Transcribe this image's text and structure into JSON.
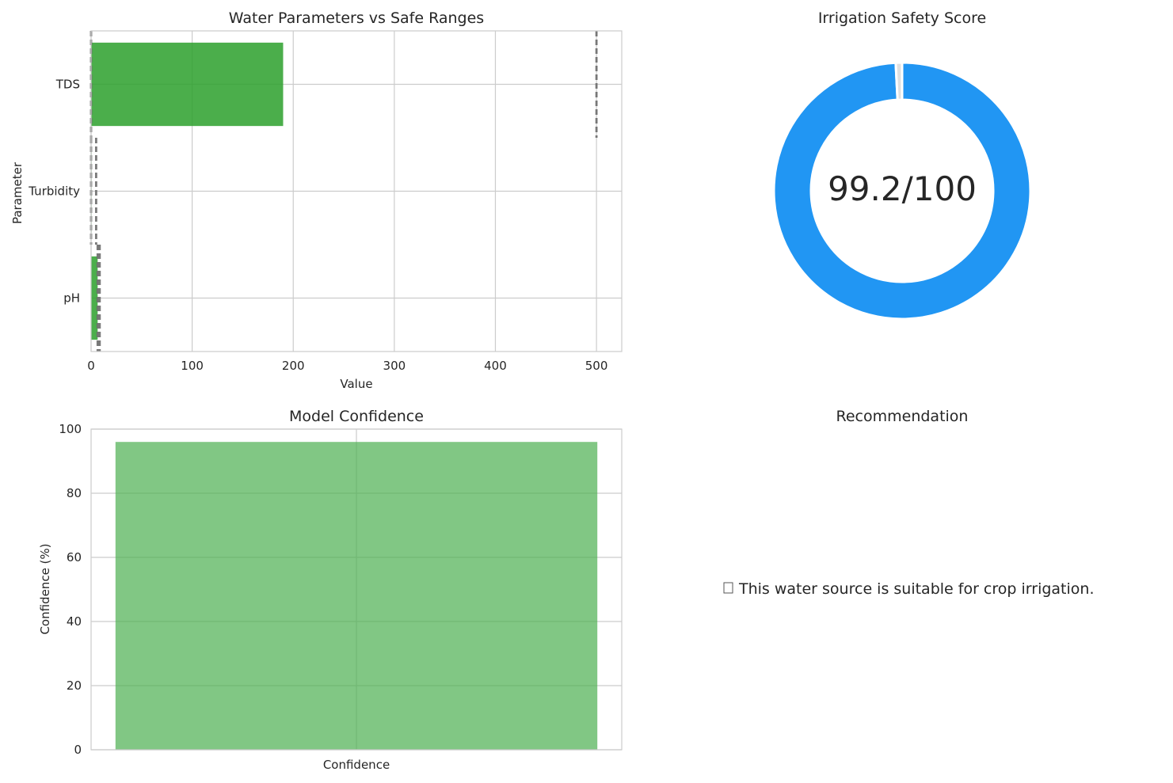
{
  "charts": [
    {
      "id": "params",
      "chart_data": {
        "type": "bar",
        "orientation": "horizontal",
        "title": "Water Parameters vs Safe Ranges",
        "xlabel": "Value",
        "ylabel": "Parameter",
        "categories": [
          "pH",
          "Turbidity",
          "TDS"
        ],
        "values": [
          6.5,
          0.5,
          190
        ],
        "safe_ranges": [
          [
            6.5,
            8.5
          ],
          [
            0,
            5
          ],
          [
            0,
            500
          ]
        ],
        "xlim": [
          0,
          525
        ],
        "xticks": [
          0,
          100,
          200,
          300,
          400,
          500
        ],
        "bar_color": "#2ca02c",
        "range_line_color": "#6b6b6b",
        "grid": true
      }
    },
    {
      "id": "safety",
      "chart_data": {
        "type": "pie",
        "style": "donut",
        "title": "Irrigation Safety Score",
        "score": 99.2,
        "max": 100,
        "center_label": "99.2/100",
        "colors": {
          "score": "#2196f3",
          "remainder": "#e0e0e0"
        }
      }
    },
    {
      "id": "confidence",
      "chart_data": {
        "type": "bar",
        "title": "Model Confidence",
        "categories": [
          "Confidence"
        ],
        "values": [
          96
        ],
        "ylabel": "Confidence (%)",
        "ylim": [
          0,
          100
        ],
        "yticks": [
          0,
          20,
          40,
          60,
          80,
          100
        ],
        "bar_color": "#4caf50",
        "grid": true
      }
    }
  ],
  "recommendation": {
    "title": "Recommendation",
    "icon": "check-mark-icon",
    "text": "This water source is suitable for crop irrigation."
  }
}
